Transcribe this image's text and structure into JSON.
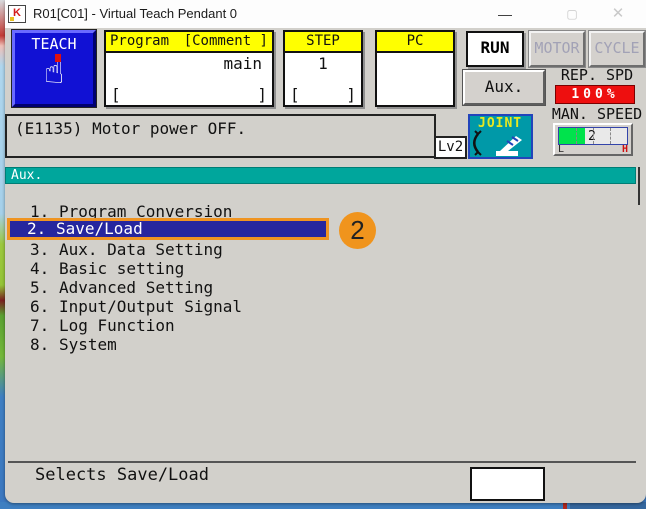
{
  "colors": {
    "teach_blue": "#1111d4",
    "header_yellow": "#ffff00",
    "accent_teal": "#00a69c",
    "joint_teal": "#0099a8",
    "highlight_navy": "#26269e",
    "annotation_orange": "#f0941d",
    "rep_spd_red": "#ee0f0f",
    "speed_green": "#00e34c",
    "body_gray": "#d2d0cb"
  },
  "window": {
    "title": "R01[C01] - Virtual Teach Pendant 0",
    "icon_letter": "K",
    "minimize_glyph": "—",
    "maximize_glyph": "▢",
    "close_glyph": "✕"
  },
  "top": {
    "teach_label": "TEACH",
    "program": {
      "title": "Program",
      "comment": "[Comment ]",
      "value": "main",
      "lb": "[",
      "rb": "]"
    },
    "step": {
      "title": "STEP",
      "value": "1",
      "lb": "[",
      "rb": "]"
    },
    "pc": {
      "title": "PC"
    },
    "run_label": "RUN",
    "motor_label": "MOTOR",
    "cycle_label": "CYCLE",
    "aux_label": "Aux.",
    "rep_spd": {
      "label": "REP. SPD",
      "value": "100%"
    },
    "man_speed": {
      "label": "MAN. SPEED",
      "value": "2",
      "low": "L",
      "high": "H"
    }
  },
  "status": {
    "message": "(E1135) Motor power OFF.",
    "level": "Lv2",
    "joint_label": "JOINT"
  },
  "menu": {
    "header": "Aux.",
    "items": [
      {
        "number": "1.",
        "label": "Program Conversion",
        "selected": false
      },
      {
        "number": "2.",
        "label": "Save/Load",
        "selected": true
      },
      {
        "number": "3.",
        "label": "Aux. Data Setting",
        "selected": false
      },
      {
        "number": "4.",
        "label": "Basic setting",
        "selected": false
      },
      {
        "number": "5.",
        "label": "Advanced Setting",
        "selected": false
      },
      {
        "number": "6.",
        "label": "Input/Output Signal",
        "selected": false
      },
      {
        "number": "7.",
        "label": "Log Function",
        "selected": false
      },
      {
        "number": "8.",
        "label": "System",
        "selected": false
      }
    ],
    "annotation_badge": "2"
  },
  "footer": {
    "hint": "Selects Save/Load",
    "input_value": ""
  }
}
